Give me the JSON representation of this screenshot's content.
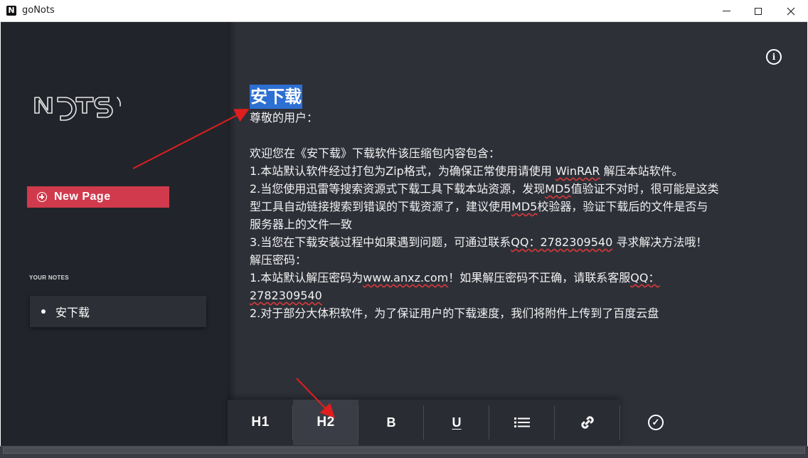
{
  "window": {
    "title": "goNots",
    "logo_letter": "N",
    "minimize_icon": "minimize-icon",
    "maximize_icon": "maximize-icon",
    "close_icon": "close-icon"
  },
  "sidebar": {
    "brand": "NOTS",
    "new_page_label": "New Page",
    "your_notes_label": "YOUR NOTES",
    "notes": [
      {
        "label": "安下载"
      }
    ]
  },
  "editor": {
    "heading": "安下载",
    "greeting": "尊敬的用户：",
    "lines": [
      "欢迎您在《安下载》下载软件该压缩包内容包含：",
      "1.本站默认软件经过打包为Zip格式，为确保正常使用请使用",
      "WinRAR",
      "解压本站软件。",
      "2.当您使用迅雷等搜索资源式下载工具下载本站资源，发现",
      "MD5",
      "值验证不对时，很可能是这类型工具自动链接搜索到错误的下载资源了，建议使用",
      "MD5",
      "校验器，验证下载后的文件是否与服务器上的文件一致",
      "3.当您在下载安装过程中如果遇到问题，可通过联系",
      "QQ：2782309540",
      "寻求解决方法哦！",
      "解压密码：",
      "1.本站默认解压密码为",
      "www.anxz.com",
      "！如果解压密码不正确，请联系客服",
      "QQ：2782309540",
      "2.对于部分大体积软件，为了保证用户的下载速度，我们将附件上传到了百度云盘"
    ]
  },
  "toolbar": {
    "h1": "H1",
    "h2": "H2",
    "bold": "B",
    "underline": "U",
    "check_symbol": "✓"
  },
  "colors": {
    "sidebar_bg": "#22242b",
    "main_bg": "#2e3038",
    "accent": "#d03a4c",
    "selection": "#2d6fd2",
    "annotation": "#e01e1e"
  }
}
